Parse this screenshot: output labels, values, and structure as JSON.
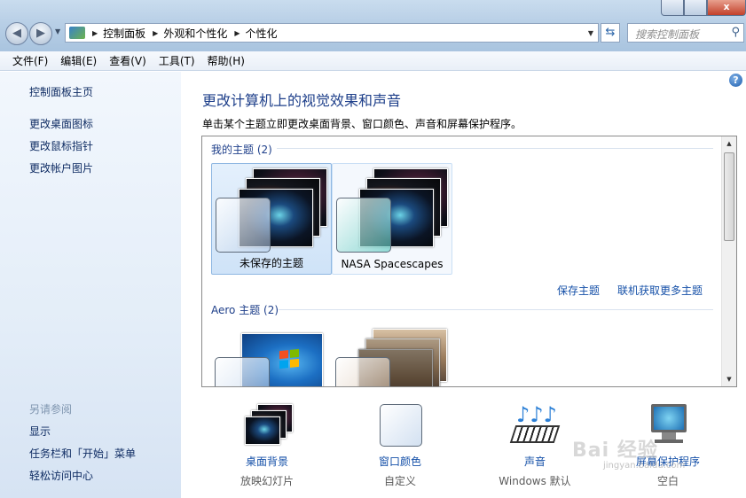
{
  "window": {
    "close_label": "x"
  },
  "address_bar": {
    "crumbs": [
      "控制面板",
      "外观和个性化",
      "个性化"
    ]
  },
  "search": {
    "placeholder": "搜索控制面板"
  },
  "menu": [
    "文件(F)",
    "编辑(E)",
    "查看(V)",
    "工具(T)",
    "帮助(H)"
  ],
  "sidebar": {
    "home": "控制面板主页",
    "links": [
      "更改桌面图标",
      "更改鼠标指针",
      "更改帐户图片"
    ],
    "see_also_label": "另请参阅",
    "see_also": [
      "显示",
      "任务栏和「开始」菜单",
      "轻松访问中心"
    ]
  },
  "main": {
    "title": "更改计算机上的视觉效果和声音",
    "description": "单击某个主题立即更改桌面背景、窗口颜色、声音和屏幕保护程序。",
    "my_themes": {
      "label": "我的主题 (2)",
      "items": [
        "未保存的主题",
        "NASA Spacescapes"
      ]
    },
    "save_theme": "保存主题",
    "get_more_themes": "联机获取更多主题",
    "aero_themes": {
      "label": "Aero 主题 (2)"
    }
  },
  "bottom": [
    {
      "title": "桌面背景",
      "sub": "放映幻灯片"
    },
    {
      "title": "窗口颜色",
      "sub": "自定义"
    },
    {
      "title": "声音",
      "sub": "Windows 默认"
    },
    {
      "title": "屏幕保护程序",
      "sub": "空白"
    }
  ],
  "watermark": {
    "text": "Bai 经验",
    "sub": "jingyan.baidu.com"
  },
  "colors": {
    "link": "#1550a8",
    "title": "#1e3f8a",
    "sidebar_link": "#0f2c63"
  }
}
